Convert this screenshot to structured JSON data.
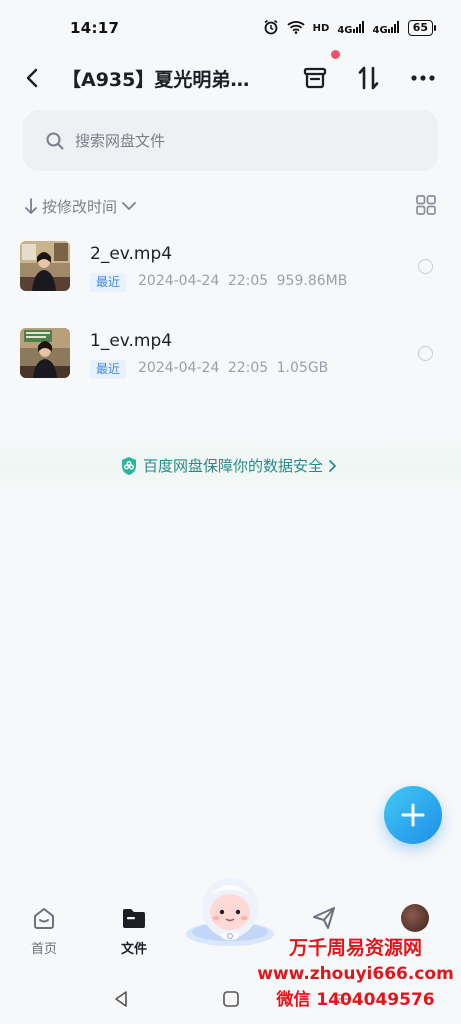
{
  "status_bar": {
    "time": "14:17",
    "hd_label": "HD",
    "signal1_label": "4G",
    "signal2_label": "4G",
    "battery": "65"
  },
  "header": {
    "title": "【A935】夏光明弟…",
    "icons": [
      "back-icon",
      "archive-icon",
      "sort-transfer-icon",
      "more-icon"
    ]
  },
  "search": {
    "placeholder": "搜索网盘文件"
  },
  "sort": {
    "label": "按修改时间"
  },
  "files": [
    {
      "name": "2_ev.mp4",
      "badge": "最近",
      "date": "2024-04-24",
      "time": "22:05",
      "size": "959.86MB"
    },
    {
      "name": "1_ev.mp4",
      "badge": "最近",
      "date": "2024-04-24",
      "time": "22:05",
      "size": "1.05GB"
    }
  ],
  "security_banner": {
    "text": "百度网盘保障你的数据安全"
  },
  "bottom_nav": {
    "items": [
      {
        "label": "首页",
        "icon": "home-icon"
      },
      {
        "label": "文件",
        "icon": "folder-icon"
      },
      {
        "label": "",
        "icon": "mascot-icon"
      },
      {
        "label": "",
        "icon": "share-send-icon"
      },
      {
        "label": "",
        "icon": "avatar-icon"
      }
    ]
  },
  "watermark": {
    "line1": "万千周易资源网",
    "line2": "www.zhouyi666.com",
    "line3": "微信 1404049576"
  },
  "colors": {
    "accent": "#3a8be8",
    "security_green": "#2a8a86",
    "fab_blue": "#1e8fe8",
    "notification_dot": "#f0506e",
    "watermark_red": "#e0161a"
  }
}
